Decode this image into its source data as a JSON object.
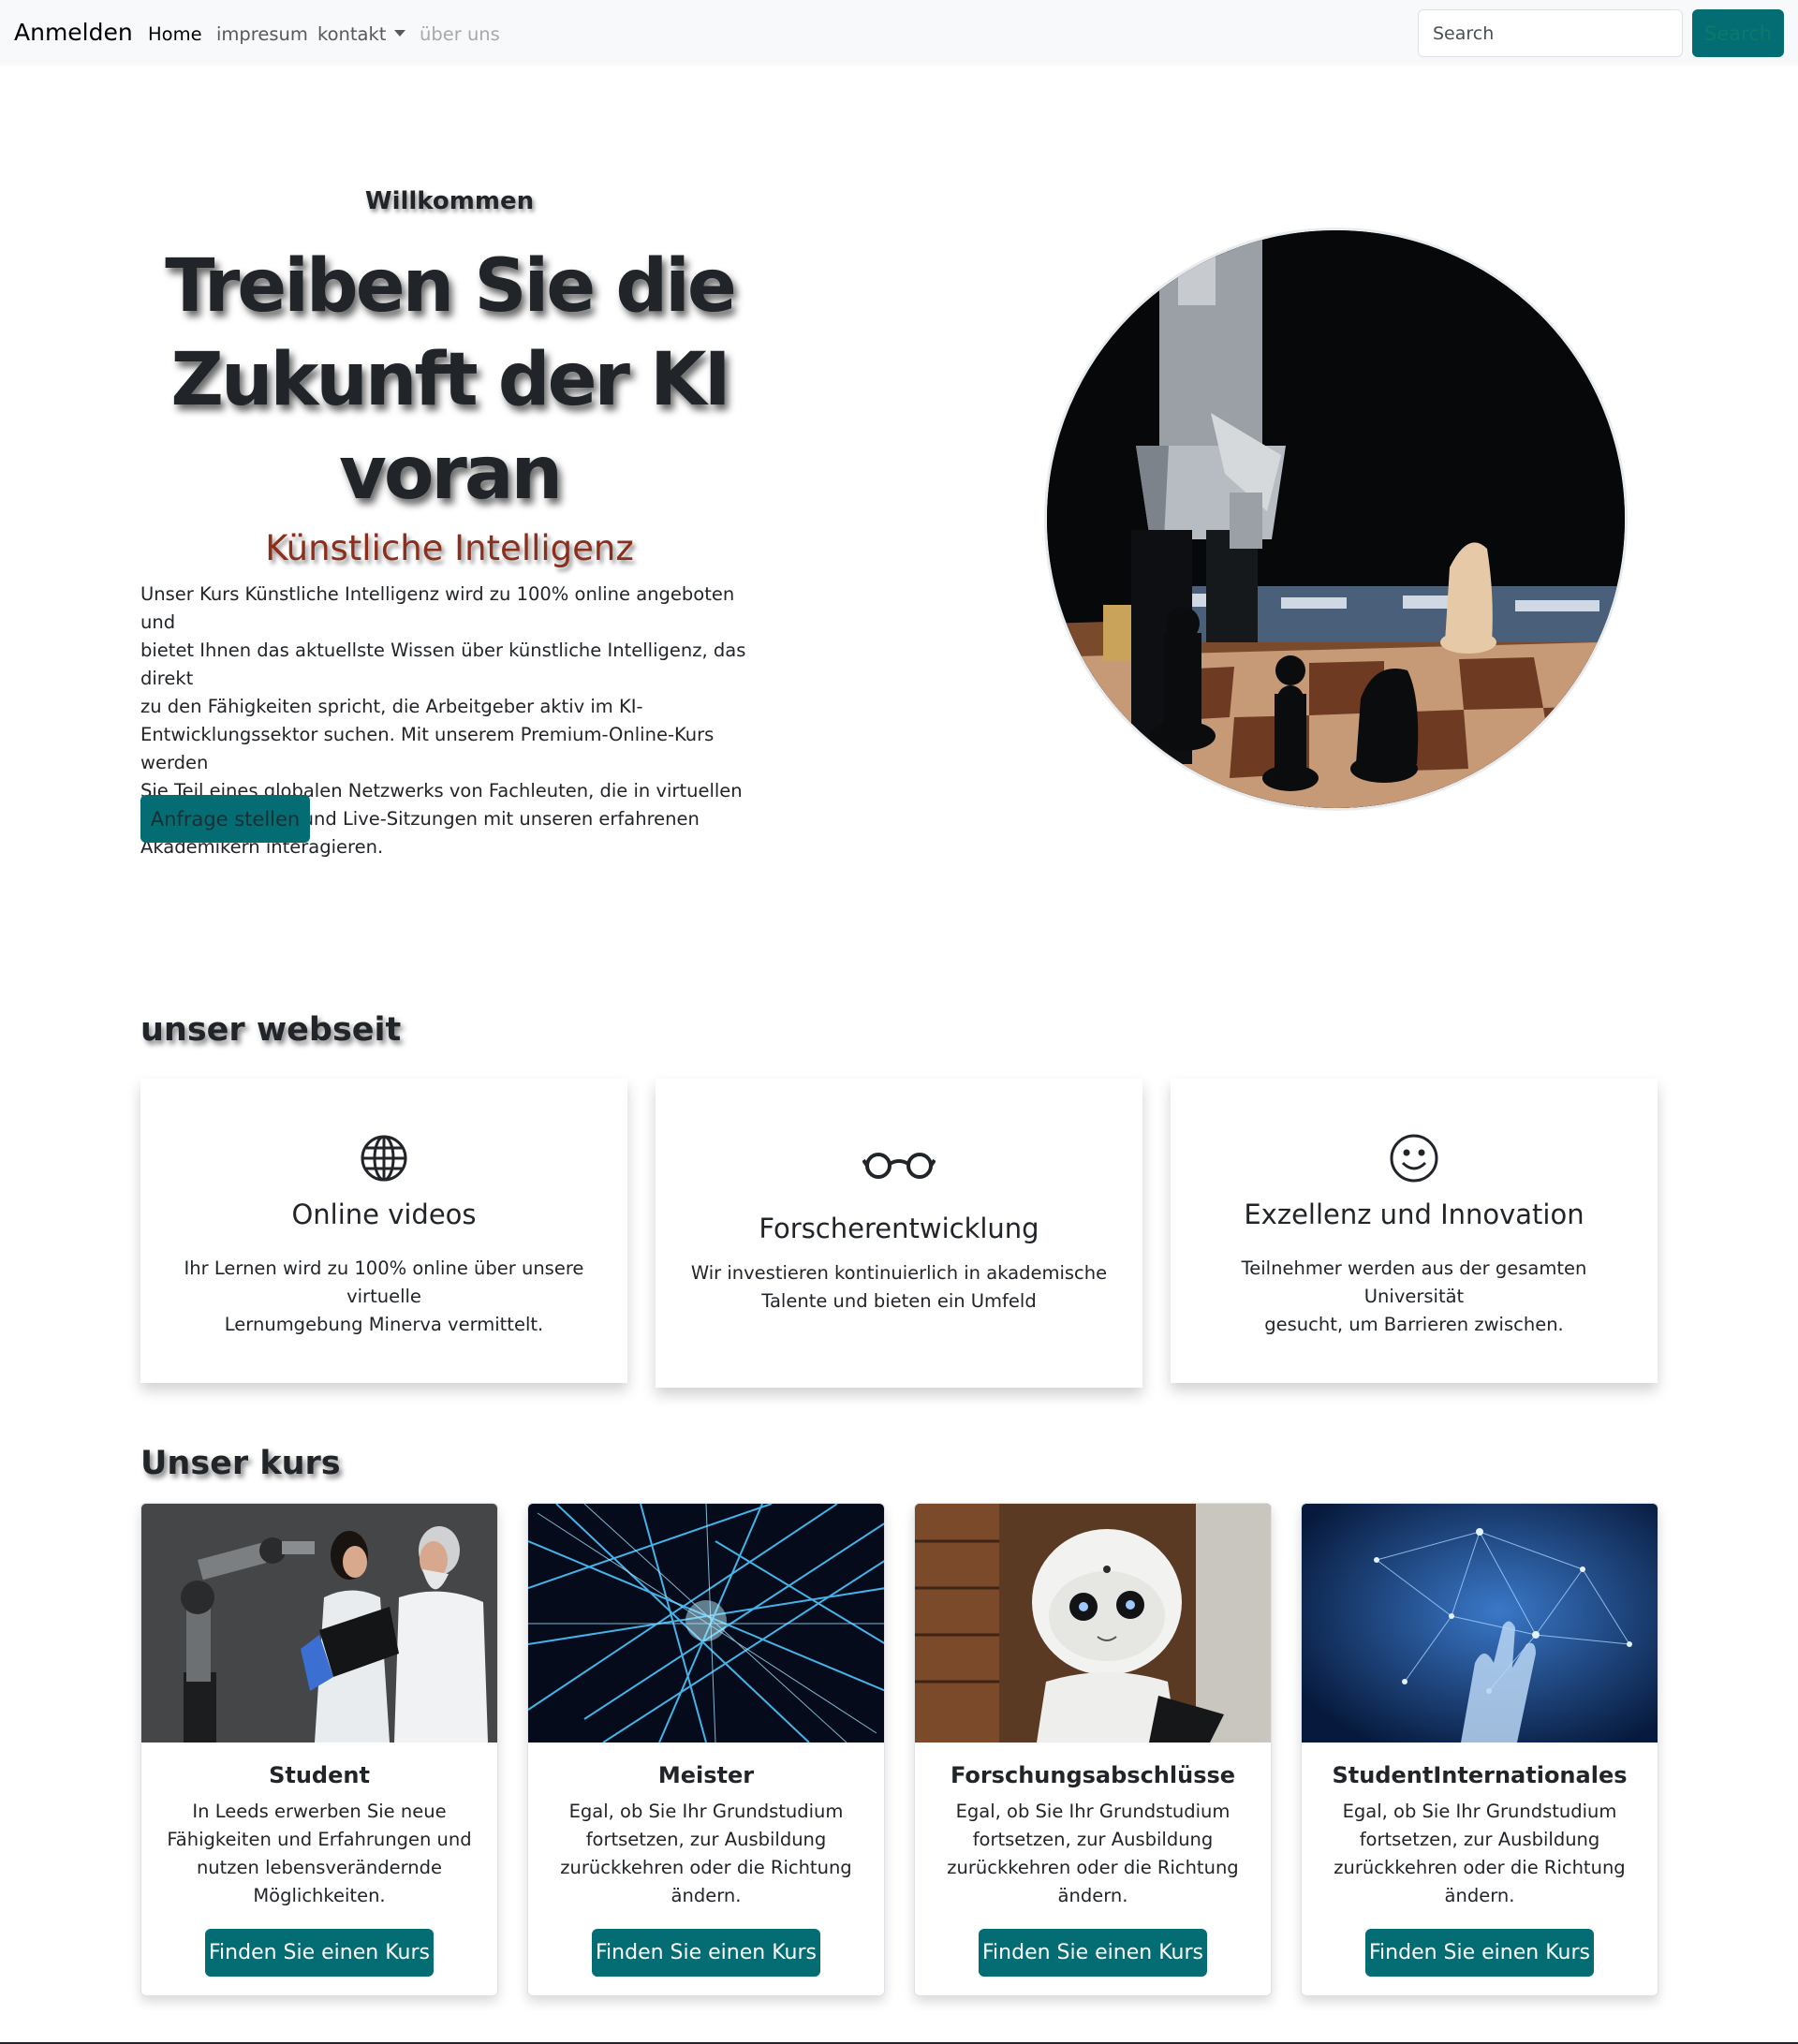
{
  "navbar": {
    "brand": "Anmelden",
    "links": [
      {
        "label": "Home"
      },
      {
        "label": "impresum"
      },
      {
        "label": "kontakt"
      },
      {
        "label": "über uns"
      }
    ],
    "search": {
      "placeholder": "Search",
      "button_label": "Search"
    }
  },
  "hero": {
    "subtitle": "Willkommen",
    "title_lines": [
      "Treiben Sie die",
      "Zukunft der KI",
      "voran"
    ],
    "topic": "Künstliche Intelligenz",
    "text_lines": [
      "Unser Kurs Künstliche Intelligenz wird zu 100% online angeboten und",
      "bietet Ihnen das aktuellste Wissen über künstliche Intelligenz, das direkt",
      "zu den Fähigkeiten spricht, die Arbeitgeber aktiv im KI-",
      "Entwicklungssektor suchen. Mit unserem Premium-Online-Kurs werden",
      "Sie Teil eines globalen Netzwerks von Fachleuten, die in virtuellen",
      "sozialen Räumen und Live-Sitzungen mit unseren erfahrenen",
      "Akademikern interagieren."
    ],
    "button_label": "Anfrage stellen"
  },
  "features_section": {
    "title": "unser webseit",
    "items": [
      {
        "icon": "globe-icon",
        "title": "Online videos",
        "text_lines": [
          "Ihr Lernen wird zu 100% online über unsere virtuelle",
          "Lernumgebung Minerva vermittelt."
        ]
      },
      {
        "icon": "eyeglasses-icon",
        "title": "Forscherentwicklung",
        "text_lines": [
          "Wir investieren kontinuierlich in akademische",
          "Talente und bieten ein Umfeld"
        ]
      },
      {
        "icon": "smiley-icon",
        "title": "Exzellenz und Innovation",
        "text_lines": [
          "Teilnehmer werden aus der gesamten Universität",
          "gesucht, um Barrieren zwischen."
        ]
      }
    ]
  },
  "courses_section": {
    "title": "Unser kurs",
    "items": [
      {
        "title": "Student",
        "text_lines": [
          "In Leeds erwerben Sie neue",
          "Fähigkeiten und Erfahrungen und",
          "nutzen lebensverändernde",
          "Möglichkeiten."
        ],
        "button_label": "Finden Sie einen Kurs"
      },
      {
        "title": "Meister",
        "text_lines": [
          "Egal, ob Sie Ihr Grundstudium",
          "fortsetzen, zur Ausbildung",
          "zurückkehren oder die Richtung",
          "ändern."
        ],
        "button_label": "Finden Sie einen Kurs"
      },
      {
        "title": "Forschungsabschlüsse",
        "text_lines": [
          "Egal, ob Sie Ihr Grundstudium",
          "fortsetzen, zur Ausbildung",
          "zurückkehren oder die Richtung",
          "ändern."
        ],
        "button_label": "Finden Sie einen Kurs"
      },
      {
        "title": "StudentInternationales",
        "text_lines": [
          "Egal, ob Sie Ihr Grundstudium",
          "fortsetzen, zur Ausbildung",
          "zurückkehren oder die Richtung",
          "ändern."
        ],
        "button_label": "Finden Sie einen Kurs"
      }
    ]
  },
  "colors": {
    "accent": "#046c73",
    "topic": "#8b2e1c",
    "navbar_bg": "#f8f9fa",
    "text": "#212529"
  }
}
